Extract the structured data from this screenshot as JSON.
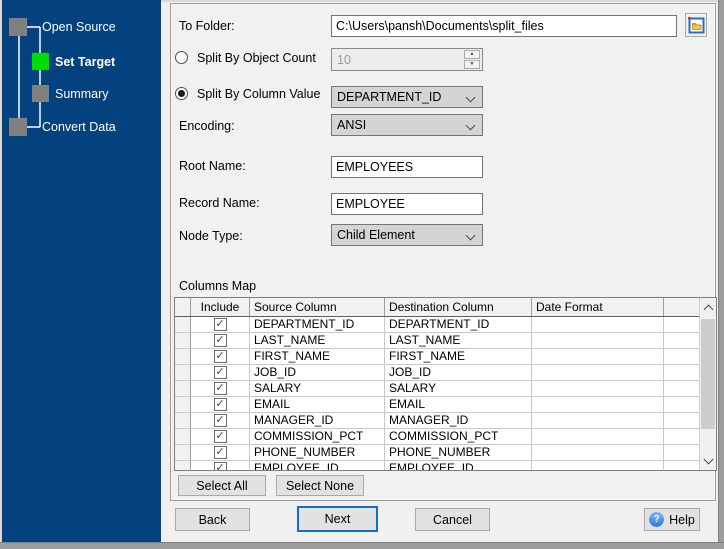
{
  "sidebar": {
    "background_color": "#04417f",
    "steps": [
      {
        "label": "Open Source",
        "state": "done",
        "square_color": "#808080"
      },
      {
        "label": "Set Target",
        "state": "active",
        "square_color": "#00dd00"
      },
      {
        "label": "Summary",
        "state": "pending",
        "square_color": "#808080"
      },
      {
        "label": "Convert Data",
        "state": "pending",
        "square_color": "#808080"
      }
    ]
  },
  "form": {
    "to_folder": {
      "label": "To Folder:",
      "value": "C:\\Users\\pansh\\Documents\\split_files"
    },
    "split_by_object_count": {
      "label": "Split By Object Count",
      "selected": false,
      "value": "10",
      "enabled": false
    },
    "split_by_column_value": {
      "label": "Split By Column Value",
      "selected": true,
      "value": "DEPARTMENT_ID"
    },
    "encoding": {
      "label": "Encoding:",
      "value": "ANSI"
    },
    "root_name": {
      "label": "Root Name:",
      "value": "EMPLOYEES"
    },
    "record_name": {
      "label": "Record Name:",
      "value": "EMPLOYEE"
    },
    "node_type": {
      "label": "Node Type:",
      "value": "Child Element"
    }
  },
  "columns_map": {
    "title": "Columns Map",
    "headers": [
      "Include",
      "Source Column",
      "Destination Column",
      "Date Format"
    ],
    "check_glyph": "✓",
    "rows": [
      {
        "include": true,
        "source": "DEPARTMENT_ID",
        "destination": "DEPARTMENT_ID",
        "date_format": ""
      },
      {
        "include": true,
        "source": "LAST_NAME",
        "destination": "LAST_NAME",
        "date_format": ""
      },
      {
        "include": true,
        "source": "FIRST_NAME",
        "destination": "FIRST_NAME",
        "date_format": ""
      },
      {
        "include": true,
        "source": "JOB_ID",
        "destination": "JOB_ID",
        "date_format": ""
      },
      {
        "include": true,
        "source": "SALARY",
        "destination": "SALARY",
        "date_format": ""
      },
      {
        "include": true,
        "source": "EMAIL",
        "destination": "EMAIL",
        "date_format": ""
      },
      {
        "include": true,
        "source": "MANAGER_ID",
        "destination": "MANAGER_ID",
        "date_format": ""
      },
      {
        "include": true,
        "source": "COMMISSION_PCT",
        "destination": "COMMISSION_PCT",
        "date_format": ""
      },
      {
        "include": true,
        "source": "PHONE_NUMBER",
        "destination": "PHONE_NUMBER",
        "date_format": ""
      },
      {
        "include": true,
        "source": "EMPLOYEE_ID",
        "destination": "EMPLOYEE_ID",
        "date_format": ""
      }
    ],
    "buttons": {
      "select_all": "Select All",
      "select_none": "Select None"
    }
  },
  "footer": {
    "back": "Back",
    "next": "Next",
    "cancel": "Cancel",
    "help": "Help"
  },
  "icons": {
    "help_glyph": "?",
    "spin_up": "▲",
    "spin_down": "▼"
  },
  "colors": {
    "accent_blue": "#0d6fc8",
    "active_step_green": "#00dd00",
    "folder_icon_yellow": "#f7c64a"
  }
}
